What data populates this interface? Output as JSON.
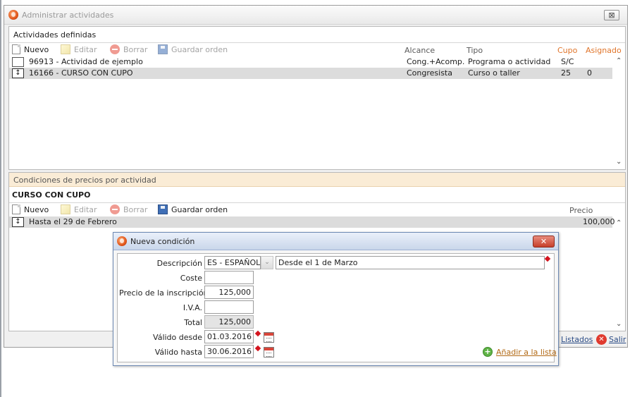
{
  "window": {
    "title": "Administrar actividades",
    "close_label": "⊠"
  },
  "activities": {
    "header": "Actividades definidas",
    "toolbar": {
      "new": "Nuevo",
      "edit": "Editar",
      "delete": "Borrar",
      "save_order": "Guardar orden"
    },
    "columns": {
      "scope": "Alcance",
      "type": "Tipo",
      "quota": "Cupo",
      "assigned": "Asignado"
    },
    "rows": [
      {
        "name": "96913 - Actividad de ejemplo",
        "scope": "Cong.+Acomp.",
        "type": "Programa o actividad",
        "quota": "S/C",
        "assigned": ""
      },
      {
        "name": "16166 - CURSO CON CUPO",
        "scope": "Congresista",
        "type": "Curso o taller",
        "quota": "25",
        "assigned": "0"
      }
    ]
  },
  "prices": {
    "header": "Condiciones de precios por actividad",
    "activity_title": "CURSO CON CUPO",
    "toolbar": {
      "new": "Nuevo",
      "edit": "Editar",
      "delete": "Borrar",
      "save_order": "Guardar orden"
    },
    "columns": {
      "price": "Precio"
    },
    "rows": [
      {
        "name": "Hasta el 29 de Febrero",
        "price": "100,000"
      }
    ]
  },
  "footer": {
    "reports": "Listados",
    "exit": "Salir"
  },
  "dialog": {
    "title": "Nueva condición",
    "fields": {
      "description_label": "Descripción",
      "language": "ES - ESPAÑOL",
      "description": "Desde el 1 de Marzo",
      "cost_label": "Coste",
      "cost": "",
      "price_label": "Precio de la inscripción",
      "price": "125,000",
      "vat_label": "I.V.A.",
      "vat": "",
      "total_label": "Total",
      "total": "125,000",
      "valid_from_label": "Válido desde",
      "valid_from": "01.03.2016",
      "valid_to_label": "Válido hasta",
      "valid_to": "30.06.2016"
    },
    "add_label": "Añadir a la lista",
    "close_label": "✕"
  },
  "colors": {
    "accent_orange": "#e0752b",
    "selected_row": "#dcdcdc",
    "section_band": "#faecd6",
    "required": "#d4141e",
    "dialog_close": "#c73f2a"
  },
  "icons": [
    "app-icon",
    "close-icon",
    "new-document-icon",
    "edit-icon",
    "delete-icon",
    "save-icon",
    "drag-handle-icon",
    "scroll-up-icon",
    "scroll-down-icon",
    "dropdown-arrow-icon",
    "calendar-icon",
    "add-icon",
    "exit-icon"
  ]
}
